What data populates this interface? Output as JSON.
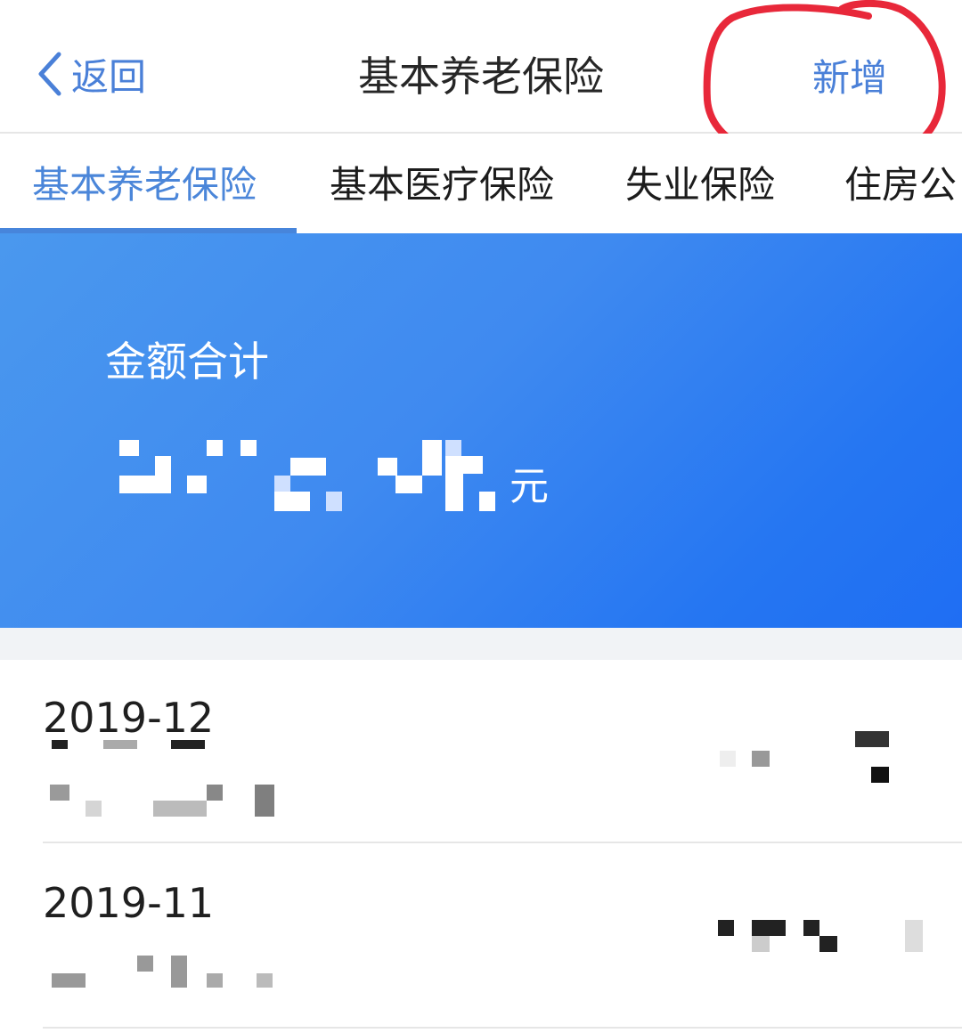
{
  "navbar": {
    "back_label": "返回",
    "title": "基本养老保险",
    "action_label": "新增",
    "accent_color": "#4a80d8",
    "annotation_color": "#e8283a"
  },
  "tabs": [
    {
      "label": "基本养老保险",
      "active": true
    },
    {
      "label": "基本医疗保险",
      "active": false
    },
    {
      "label": "失业保险",
      "active": false
    },
    {
      "label": "住房公",
      "active": false
    }
  ],
  "summary": {
    "label": "金额合计",
    "amount_pixelated": true,
    "currency": "元"
  },
  "records": [
    {
      "month": "2019-12",
      "detail_pixelated": true,
      "amount_pixelated": true
    },
    {
      "month": "2019-11",
      "detail_pixelated": true,
      "amount_pixelated": true
    }
  ],
  "icons": {
    "back": "chevron-left-icon"
  }
}
